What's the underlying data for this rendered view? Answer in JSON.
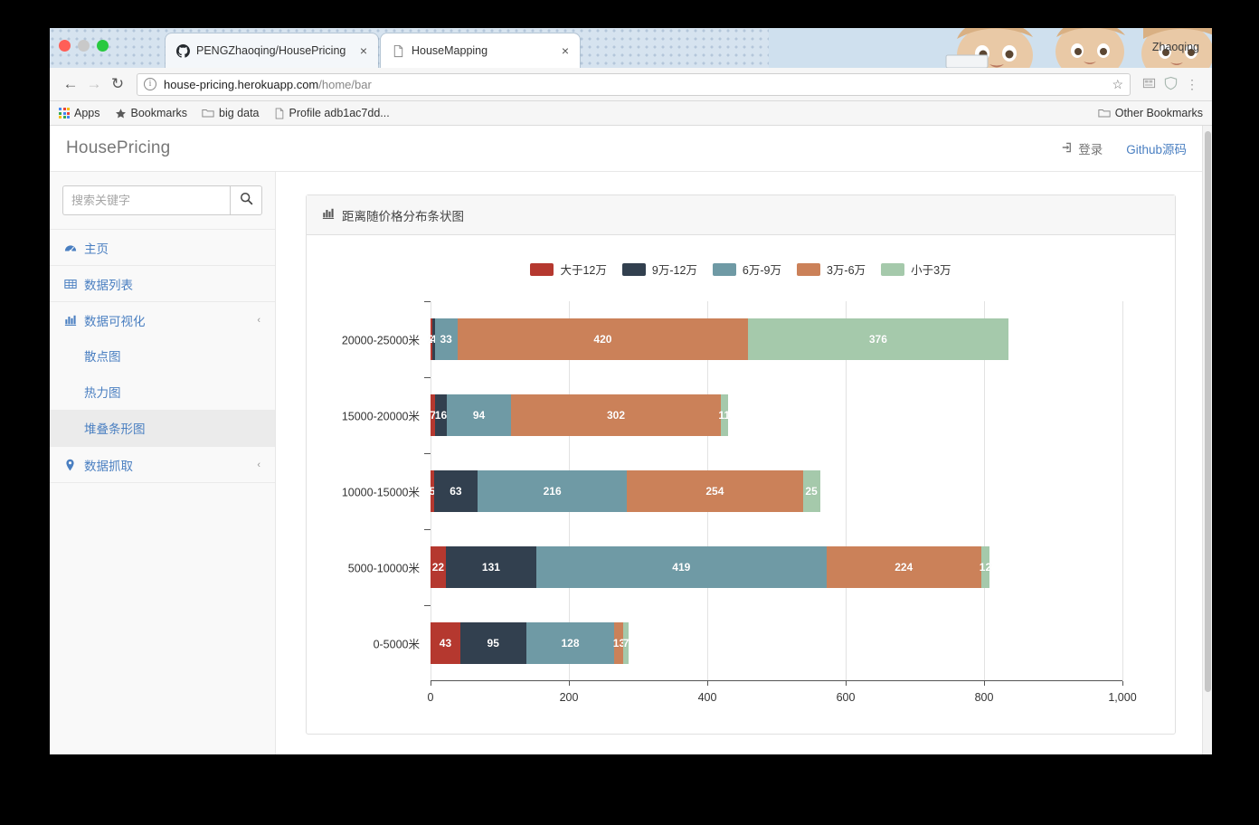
{
  "window": {
    "user_label": "Zhaoqing",
    "tabs": [
      {
        "title": "PENGZhaoqing/HousePricing",
        "favicon": "github-icon",
        "active": false,
        "close": "×"
      },
      {
        "title": "HouseMapping",
        "favicon": "page-icon",
        "active": true,
        "close": "×"
      }
    ]
  },
  "browser": {
    "back_icon": "←",
    "forward_icon": "→",
    "reload_icon": "↻",
    "info_icon": "i",
    "url_host": "house-pricing.herokuapp.com",
    "url_path": "/home/bar",
    "star_icon": "☆",
    "extension_icon": "extension-icon",
    "shield_icon": "shield-icon",
    "menu_icon": "⋮",
    "bookmarks": [
      {
        "label": "Apps",
        "icon": "apps-grid-icon"
      },
      {
        "label": "Bookmarks",
        "icon": "star-icon"
      },
      {
        "label": "big data",
        "icon": "folder-icon"
      },
      {
        "label": "Profile adb1ac7dd...",
        "icon": "page-icon"
      }
    ],
    "other_bookmarks": {
      "label": "Other Bookmarks",
      "icon": "folder-icon"
    }
  },
  "app": {
    "brand": "HousePricing",
    "login_label": "登录",
    "login_icon": "sign-in-icon",
    "github_label": "Github源码"
  },
  "sidebar": {
    "search": {
      "placeholder": "搜索关键字",
      "value": "",
      "button_icon": "search-icon"
    },
    "items": [
      {
        "label": "主页",
        "icon": "dashboard-icon",
        "caret": ""
      },
      {
        "label": "数据列表",
        "icon": "table-icon",
        "caret": ""
      },
      {
        "label": "数据可视化",
        "icon": "bar-chart-icon",
        "caret": "‹"
      }
    ],
    "sub_items": [
      {
        "label": "散点图",
        "active": false
      },
      {
        "label": "热力图",
        "active": false
      },
      {
        "label": "堆叠条形图",
        "active": true
      }
    ],
    "items_after": [
      {
        "label": "数据抓取",
        "icon": "map-pin-icon",
        "caret": "‹"
      }
    ]
  },
  "panel": {
    "title": "距离随价格分布条状图",
    "title_icon": "bar-chart-icon"
  },
  "chart_data": {
    "type": "bar",
    "orientation": "horizontal",
    "stacked": true,
    "title": "距离随价格分布条状图",
    "xlabel": "",
    "ylabel": "",
    "xlim": [
      0,
      1000
    ],
    "xticks": [
      0,
      200,
      400,
      600,
      800,
      1000
    ],
    "xtick_labels": [
      "0",
      "200",
      "400",
      "600",
      "800",
      "1,000"
    ],
    "grid": true,
    "legend_position": "top-center",
    "categories": [
      "0-5000米",
      "5000-10000米",
      "10000-15000米",
      "15000-20000米",
      "20000-25000米"
    ],
    "series": [
      {
        "name": "大于12万",
        "color": "#b5382f",
        "values": [
          43,
          22,
          5,
          7,
          2
        ]
      },
      {
        "name": "9万-12万",
        "color": "#32404f",
        "values": [
          95,
          131,
          63,
          16,
          4
        ]
      },
      {
        "name": "6万-9万",
        "color": "#6f9aa5",
        "values": [
          128,
          419,
          216,
          94,
          33
        ]
      },
      {
        "name": "3万-6万",
        "color": "#cb8159",
        "values": [
          13,
          224,
          254,
          302,
          420
        ]
      },
      {
        "name": "小于3万",
        "color": "#a5c9ab",
        "values": [
          7,
          12,
          25,
          11,
          376
        ]
      }
    ]
  }
}
